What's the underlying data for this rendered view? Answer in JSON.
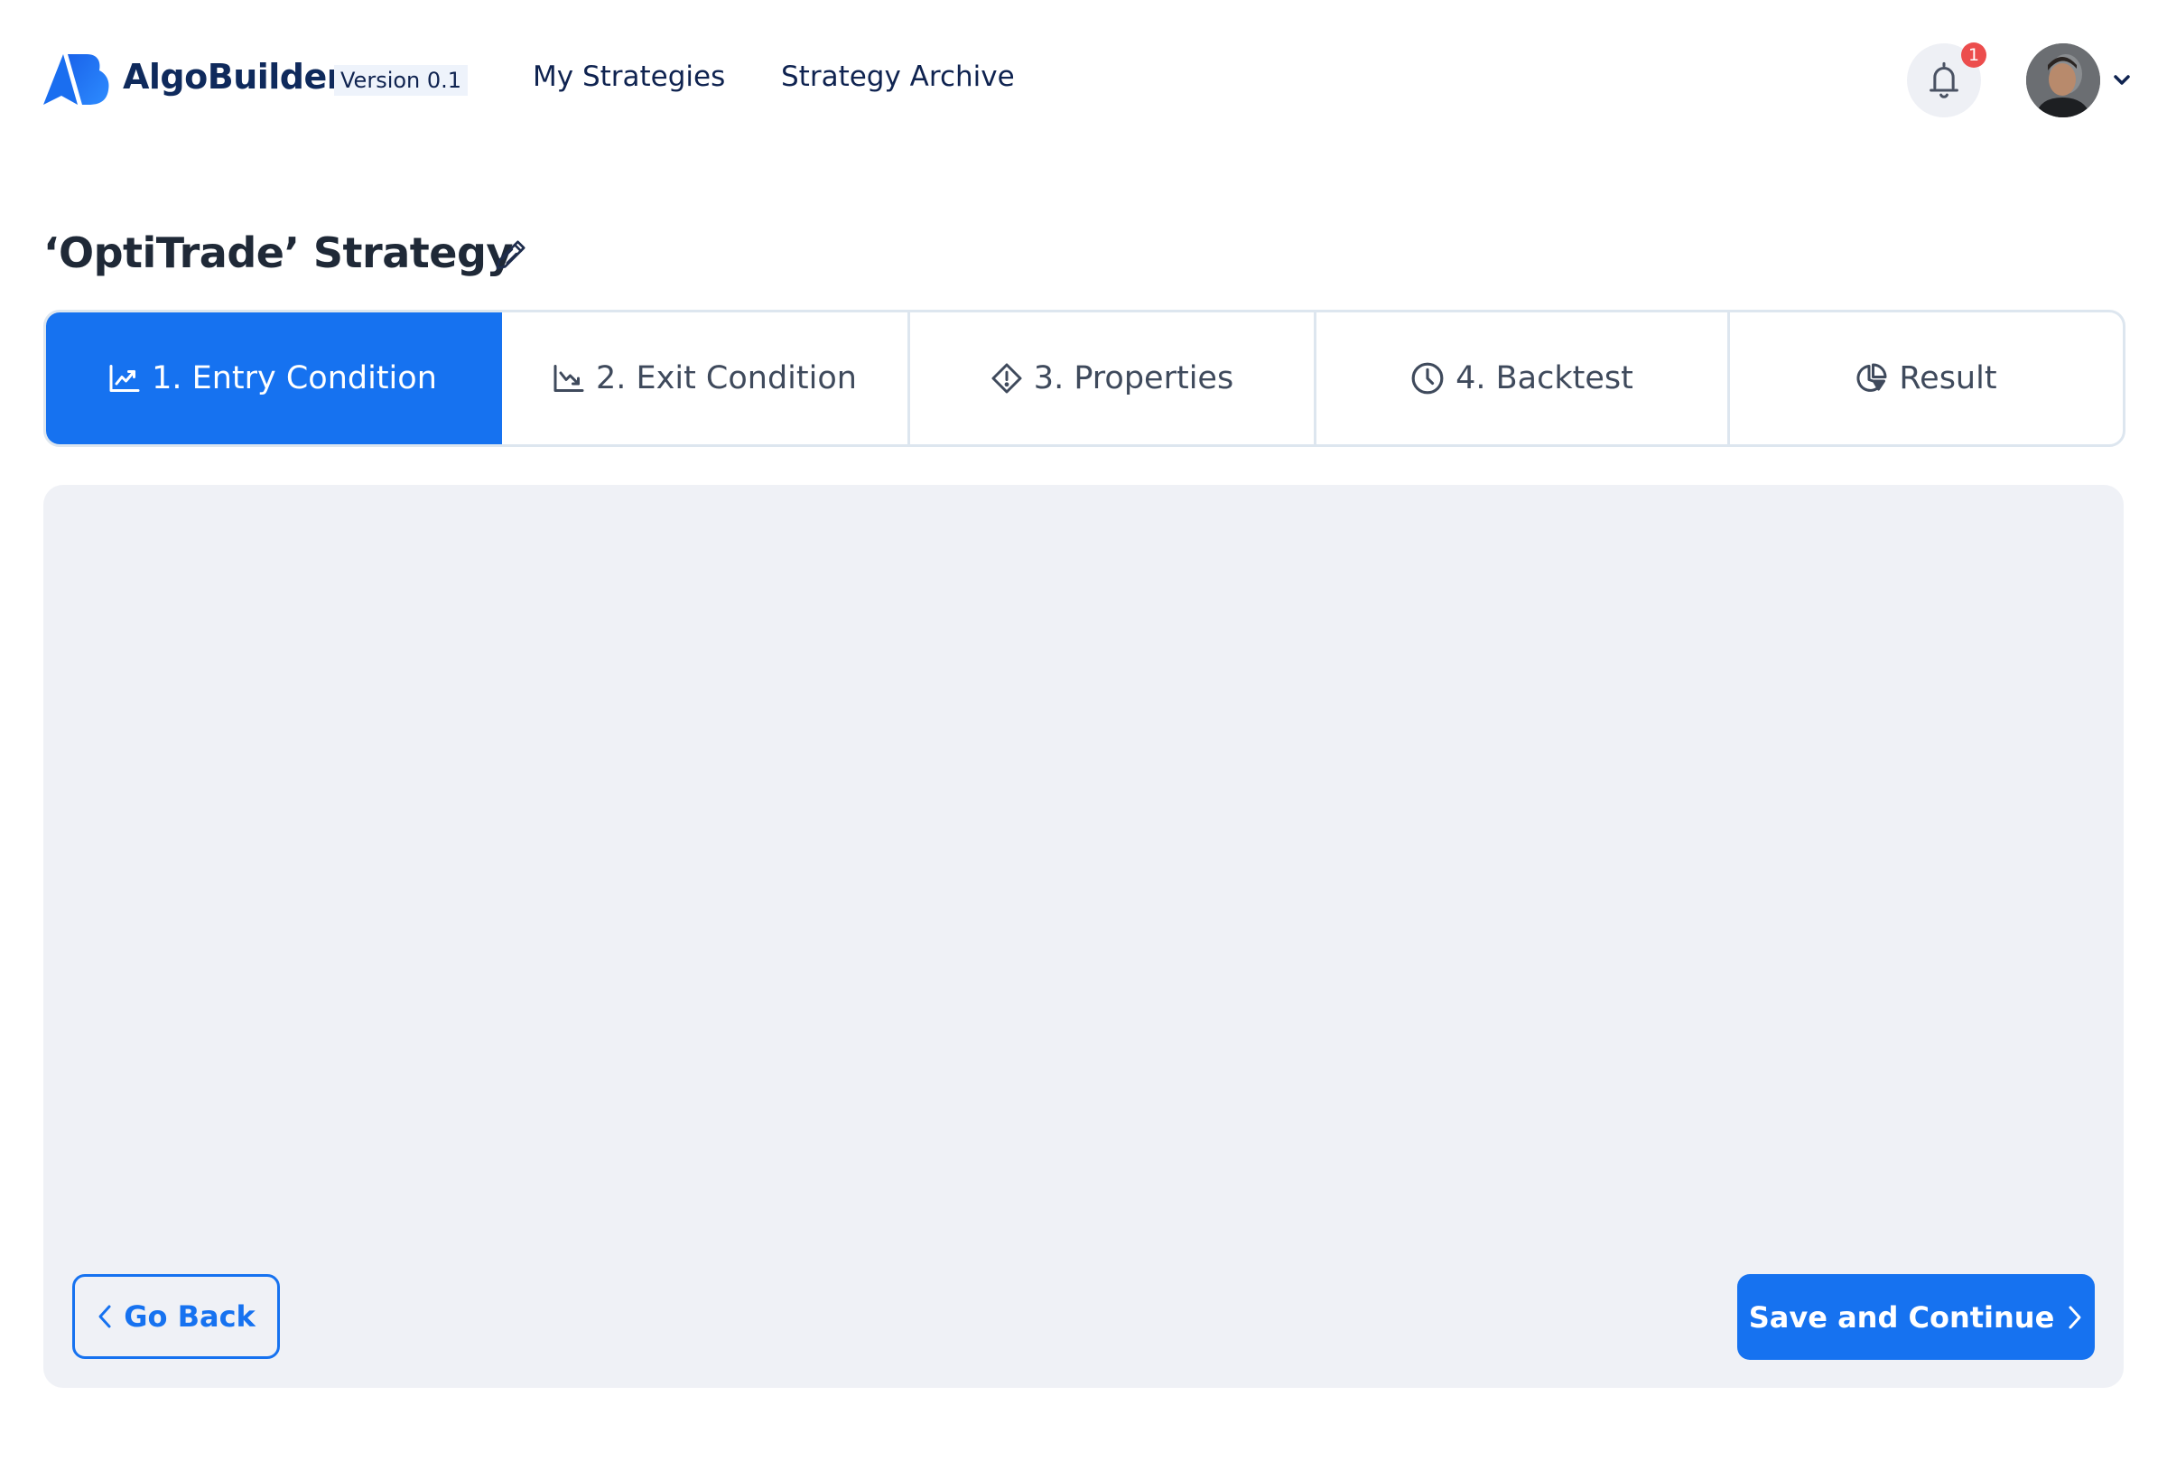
{
  "header": {
    "brand": "AlgoBuilder",
    "version": "Version 0.1",
    "nav": [
      {
        "label": "My Strategies"
      },
      {
        "label": "Strategy Archive"
      }
    ],
    "notifications": {
      "icon": "bell-icon",
      "count": "1"
    },
    "user": {
      "avatar": "user-avatar",
      "menu_icon": "chevron-down-icon"
    }
  },
  "page": {
    "title": "‘OptiTrade’ Strategy",
    "edit_icon": "pencil-icon"
  },
  "tabs": [
    {
      "label": "1. Entry Condition",
      "icon": "chart-trend-up-icon",
      "active": true
    },
    {
      "label": "2. Exit Condition",
      "icon": "chart-trend-down-icon",
      "active": false
    },
    {
      "label": "3. Properties",
      "icon": "diamond-alert-icon",
      "active": false
    },
    {
      "label": "4. Backtest",
      "icon": "clock-icon",
      "active": false
    },
    {
      "label": "Result",
      "icon": "pie-chart-icon",
      "active": false
    }
  ],
  "actions": {
    "back_label": "Go Back",
    "save_label": "Save and Continue"
  },
  "colors": {
    "accent": "#1672f0",
    "badge": "#ec4d4d",
    "panel_bg": "#eff1f6",
    "text_dark": "#0f2350"
  }
}
